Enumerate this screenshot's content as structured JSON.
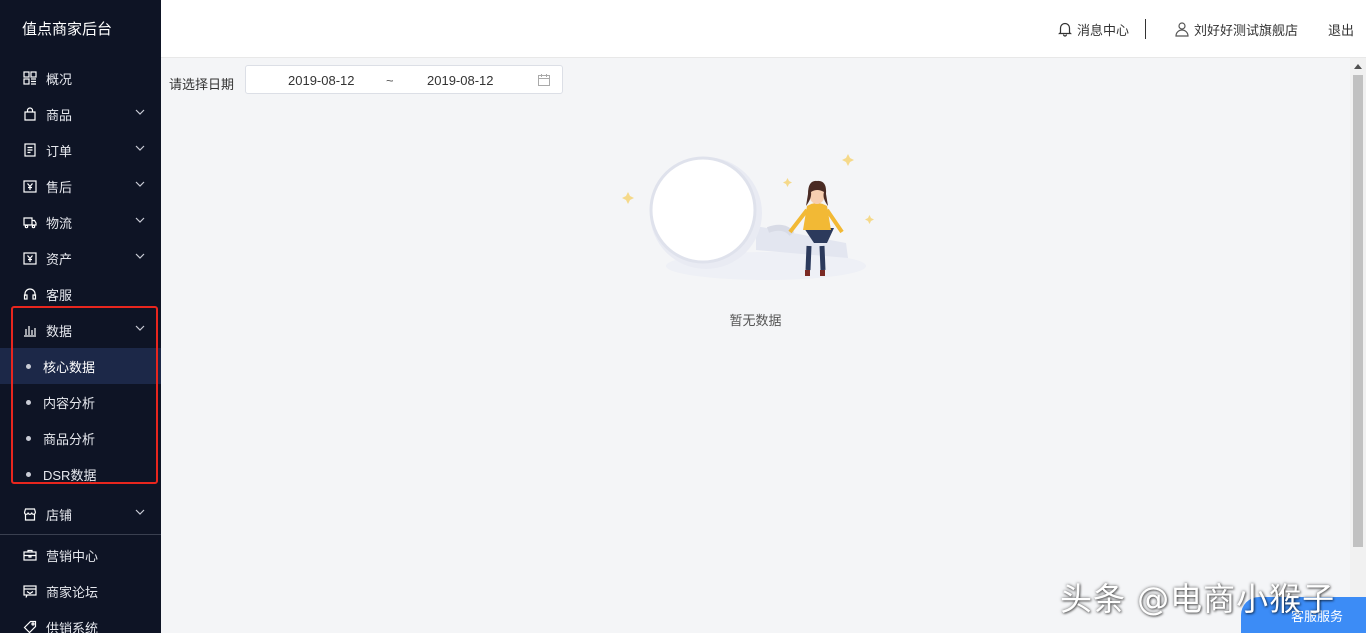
{
  "brand": "值点商家后台",
  "nav": {
    "overview": "概况",
    "goods": "商品",
    "orders": "订单",
    "aftersale": "售后",
    "logistics": "物流",
    "assets": "资产",
    "service": "客服",
    "data": "数据",
    "data_sub": [
      "核心数据",
      "内容分析",
      "商品分析",
      "DSR数据"
    ],
    "shop": "店铺",
    "marketing": "营销中心",
    "forum": "商家论坛",
    "supply": "供销系统"
  },
  "topbar": {
    "message_center": "消息中心",
    "user": "刘好好测试旗舰店",
    "logout": "退出"
  },
  "filter": {
    "label": "请选择日期",
    "start": "2019-08-12",
    "separator": "~",
    "end": "2019-08-12"
  },
  "empty_text": "暂无数据",
  "customer_service": "客服服务",
  "watermark": "头条 @电商小猴子",
  "colors": {
    "sidebar_bg": "#0e1425",
    "active_bg": "#1c2848",
    "highlight_border": "#e8261e",
    "accent": "#3c8cf6"
  }
}
